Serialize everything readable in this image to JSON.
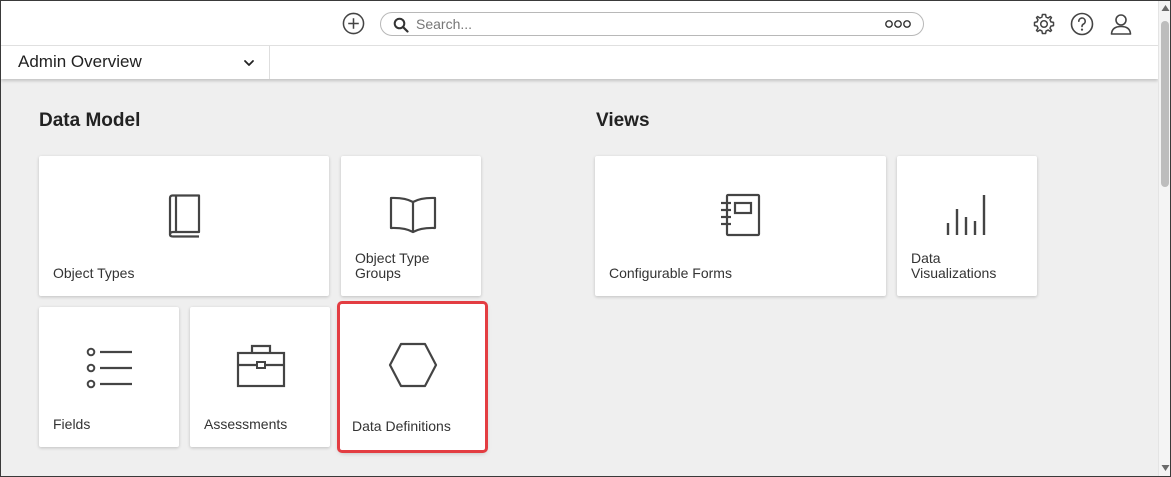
{
  "header": {
    "search_placeholder": "Search...",
    "icons": [
      "plus-circle-icon",
      "search-icon",
      "more-options-icon",
      "gear-icon",
      "help-icon",
      "user-icon"
    ]
  },
  "subbar": {
    "view_label": "Admin Overview"
  },
  "data_model": {
    "title": "Data Model",
    "cards": [
      {
        "label": "Object Types",
        "icon": "book-icon"
      },
      {
        "label": "Object Type Groups",
        "icon": "open-book-icon"
      },
      {
        "label": "Fields",
        "icon": "list-icon"
      },
      {
        "label": "Assessments",
        "icon": "briefcase-icon"
      },
      {
        "label": "Data Definitions",
        "icon": "hexagon-icon"
      }
    ]
  },
  "views": {
    "title": "Views",
    "cards": [
      {
        "label": "Configurable Forms",
        "icon": "notebook-icon"
      },
      {
        "label": "Data Visualizations",
        "icon": "bar-chart-icon"
      }
    ]
  },
  "colors": {
    "highlight": "#e33d42",
    "background": "#efefef",
    "icon": "#444444"
  }
}
